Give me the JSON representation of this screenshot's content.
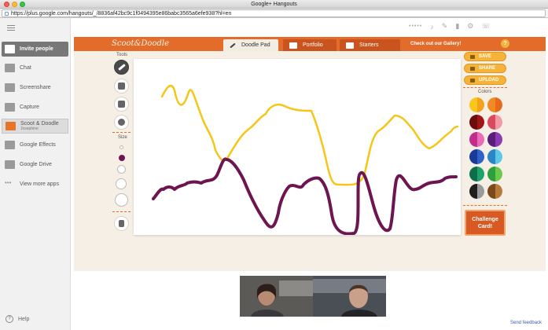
{
  "window": {
    "title": "Google+ Hangouts",
    "url": "https://plus.google.com/hangouts/_/8836af42bc9c1f0494395e86babc3565a6efe938?hl=en"
  },
  "sidebar": {
    "items": [
      {
        "label": "Invite people",
        "icon": "add-person-icon"
      },
      {
        "label": "Chat",
        "icon": "chat-icon"
      },
      {
        "label": "Screenshare",
        "icon": "screenshare-icon"
      },
      {
        "label": "Capture",
        "icon": "camera-icon"
      },
      {
        "label": "Scoot & Doodle",
        "sub": "Josephine",
        "icon": "scoot-doodle-icon"
      },
      {
        "label": "Google Effects",
        "icon": "effects-icon"
      },
      {
        "label": "Google Drive",
        "icon": "drive-icon"
      },
      {
        "label": "View more apps",
        "icon": "more-apps-icon"
      }
    ],
    "help": "Help"
  },
  "app": {
    "logo": "Scoot&Doodle",
    "tabs": [
      {
        "label": "Doodle Pad",
        "active": true
      },
      {
        "label": "Portfolio",
        "active": false
      },
      {
        "label": "Starters",
        "active": false
      }
    ],
    "gallery_link": "Check out our Gallery!",
    "tools_label": "Tools",
    "size_label": "Size",
    "actions": [
      "SAVE",
      "SHARE",
      "UPLOAD"
    ],
    "colors_label": "Colors",
    "palette": [
      [
        "#f9c61a",
        "#f4a11d"
      ],
      [
        "#f08a24",
        "#e8681c"
      ],
      [
        "#6b0d0d",
        "#a01616"
      ],
      [
        "#d94a5e",
        "#f19aa6"
      ],
      [
        "#c22d8c",
        "#ea6cb8"
      ],
      [
        "#5a1e7a",
        "#8a3cb0"
      ],
      [
        "#1a3a9a",
        "#2f62c9"
      ],
      [
        "#2a86c4",
        "#5ec6e8"
      ],
      [
        "#0e6e4a",
        "#1ea36a"
      ],
      [
        "#2f9e3c",
        "#6cc94a"
      ],
      [
        "#1e1e1e",
        "#9a9a9a"
      ],
      [
        "#7a4a1a",
        "#b87a3a"
      ]
    ],
    "challenge": [
      "Challenge",
      "Card!"
    ]
  },
  "feedback": "Send feedback",
  "colors": {
    "accent": "#e36c2b",
    "yellow_stroke": "#f5c518",
    "purple_stroke": "#6d1550"
  }
}
